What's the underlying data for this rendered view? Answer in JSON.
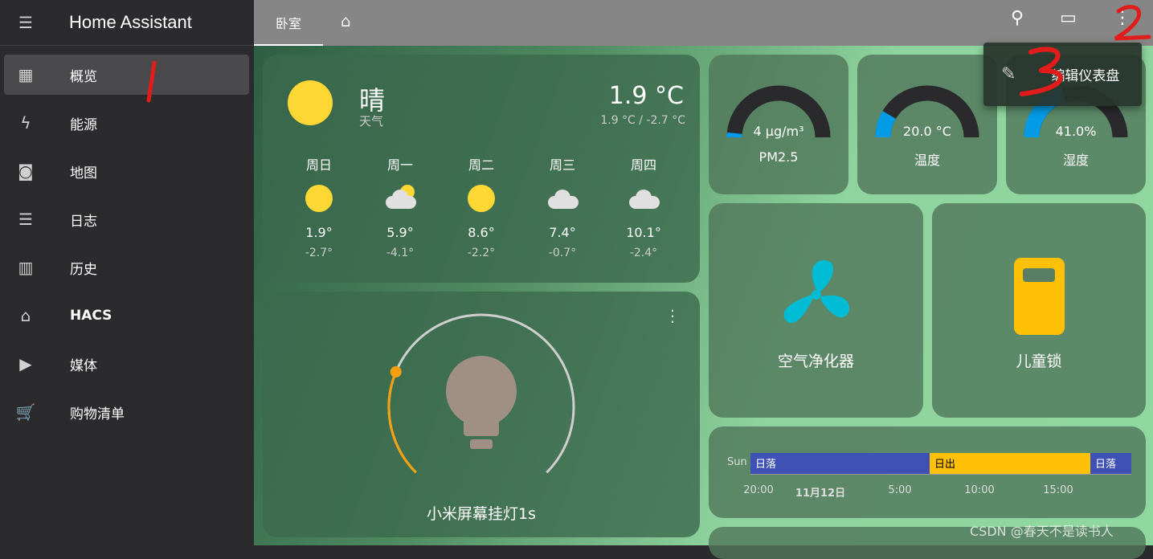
{
  "app": {
    "title": "Home Assistant"
  },
  "sidebar": {
    "items": [
      {
        "label": "概览",
        "icon": "dashboard-icon",
        "glyph": "▦",
        "active": true
      },
      {
        "label": "能源",
        "icon": "lightning-icon",
        "glyph": "ϟ"
      },
      {
        "label": "地图",
        "icon": "map-account-icon",
        "glyph": "◙"
      },
      {
        "label": "日志",
        "icon": "list-icon",
        "glyph": "☰"
      },
      {
        "label": "历史",
        "icon": "chart-icon",
        "glyph": "▥"
      },
      {
        "label": "HACS",
        "icon": "hacs-store-icon",
        "glyph": "⌂"
      },
      {
        "label": "媒体",
        "icon": "play-box-icon",
        "glyph": "▶"
      },
      {
        "label": "购物清单",
        "icon": "cart-icon",
        "glyph": "🛒"
      }
    ]
  },
  "header": {
    "tab": "卧室",
    "home_icon": "home-heart-icon"
  },
  "menu": {
    "edit_label": "编辑仪表盘"
  },
  "weather": {
    "condition": "晴",
    "name": "天气",
    "temp": "1.9 °C",
    "range": "1.9 °C / -2.7 °C",
    "forecast": [
      {
        "day": "周日",
        "icon": "sunny",
        "high": "1.9°",
        "low": "-2.7°"
      },
      {
        "day": "周一",
        "icon": "partly-cloudy",
        "high": "5.9°",
        "low": "-4.1°"
      },
      {
        "day": "周二",
        "icon": "sunny",
        "high": "8.6°",
        "low": "-2.2°"
      },
      {
        "day": "周三",
        "icon": "cloudy",
        "high": "7.4°",
        "low": "-0.7°"
      },
      {
        "day": "周四",
        "icon": "cloudy",
        "high": "10.1°",
        "low": "-2.4°"
      }
    ]
  },
  "gauges": [
    {
      "value": "4 μg/m³",
      "name": "PM2.5",
      "level": 0.03
    },
    {
      "value": "20.0 °C",
      "name": "温度",
      "level": 0.17
    },
    {
      "value": "41.0%",
      "name": "湿度",
      "level": 0.41
    }
  ],
  "light": {
    "name": "小米屏幕挂灯1s",
    "brightness": 0.25,
    "colors": {
      "arc": "#f5a00f",
      "track": "#cfcfcf",
      "bulb": "#a09084"
    }
  },
  "tiles": [
    {
      "name": "空气净化器",
      "icon": "fan-icon",
      "color": "#00bcd4"
    },
    {
      "name": "儿童锁",
      "icon": "lock-device-icon",
      "color": "#ffc107"
    }
  ],
  "timeline": {
    "row": "Sun",
    "segments": [
      {
        "label": "日落",
        "color": "#3f51b5"
      },
      {
        "label": "日出",
        "color": "#ffc107"
      },
      {
        "label": "日落",
        "color": "#3f51b5"
      }
    ],
    "ticks": [
      "20:00",
      "11月12日",
      "5:00",
      "10:00",
      "15:00"
    ]
  },
  "watermark": "CSDN @春天不是读书人",
  "annotations": [
    "1",
    "2",
    "3"
  ]
}
